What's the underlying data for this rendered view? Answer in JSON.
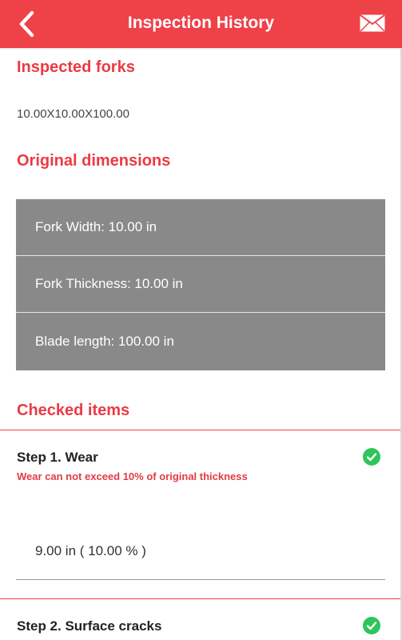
{
  "header": {
    "title": "Inspection History",
    "back_icon": "chevron-left-icon",
    "mail_icon": "envelope-icon"
  },
  "inspected_forks": {
    "title": "Inspected forks",
    "value": "10.00X10.00X100.00"
  },
  "original_dimensions": {
    "title": "Original dimensions",
    "rows": [
      {
        "label": "Fork Width: 10.00 in"
      },
      {
        "label": "Fork Thickness: 10.00 in"
      },
      {
        "label": "Blade length: 100.00 in"
      }
    ]
  },
  "checked_items": {
    "title": "Checked items",
    "steps": [
      {
        "title": "Step 1. Wear",
        "note": "Wear can not exceed 10% of original thickness",
        "value": "9.00 in ( 10.00 % )",
        "status_icon": "check-circle-icon"
      },
      {
        "title": "Step 2. Surface cracks",
        "status_icon": "check-circle-icon"
      }
    ]
  },
  "colors": {
    "accent": "#ef4148",
    "panel": "#898989",
    "success": "#2ec55c"
  }
}
